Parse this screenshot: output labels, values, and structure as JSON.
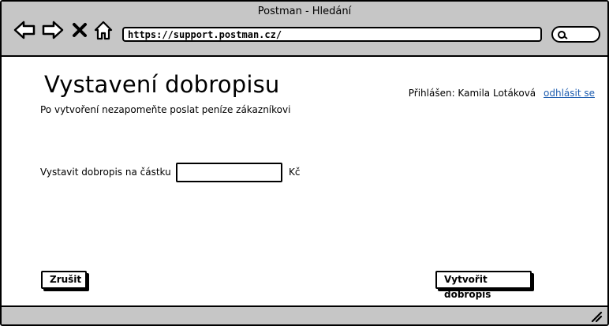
{
  "window": {
    "title": "Postman - Hledání"
  },
  "toolbar": {
    "back_icon": "arrow-left-icon",
    "forward_icon": "arrow-right-icon",
    "stop_icon": "close-icon",
    "home_icon": "home-icon",
    "url": "https://support.postman.cz/",
    "search_icon": "search-icon"
  },
  "page": {
    "title": "Vystavení dobropisu",
    "subtitle": "Po vytvoření nezapomeňte poslat peníze zákazníkovi",
    "user": {
      "logged_in_label": "Přihlášen: Kamila Lotáková",
      "logout_label": "odhlásit se"
    },
    "form": {
      "amount_label": "Vystavit dobropis na částku",
      "amount_value": "",
      "currency": "Kč"
    },
    "buttons": {
      "cancel_label": "Zrušit",
      "create_label": "Vytvořit dobropis"
    }
  },
  "colors": {
    "chrome": "#c6c6c6",
    "link": "#1f5eb0"
  }
}
